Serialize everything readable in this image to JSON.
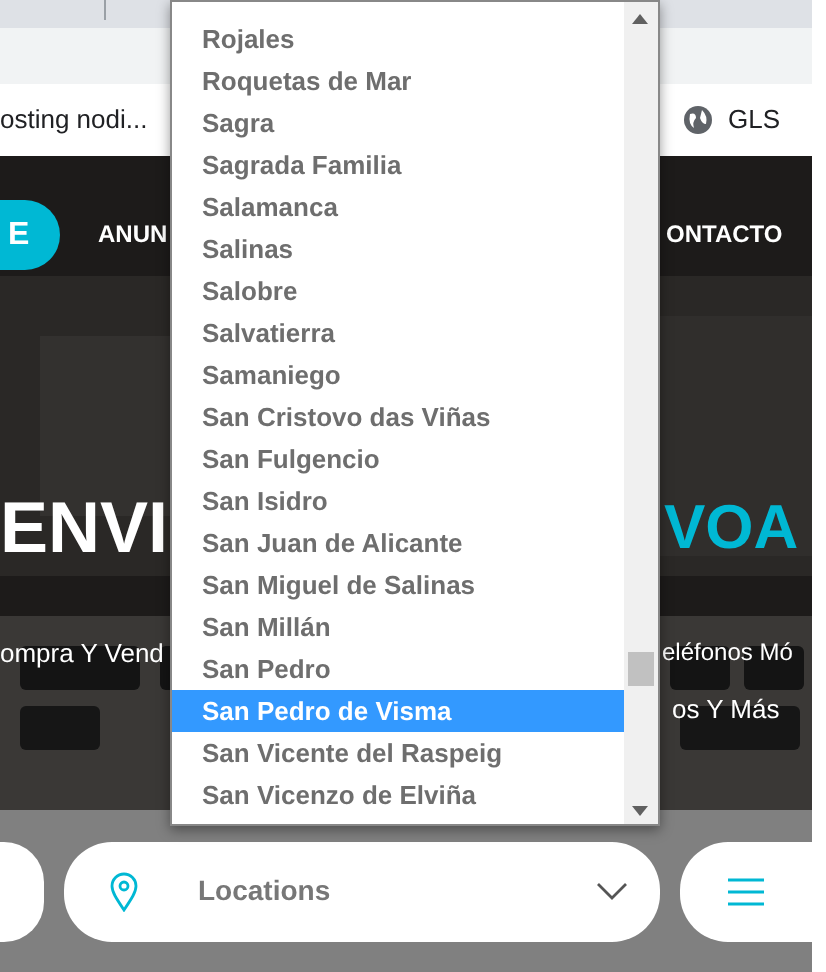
{
  "browser": {
    "bookmark": "osting nodi...",
    "bookmark_right": "GLS"
  },
  "nav": {
    "items": [
      {
        "label": "E",
        "selected": true
      },
      {
        "label": "ANUN",
        "selected": false
      },
      {
        "label": "ONTACTO",
        "selected": false
      }
    ]
  },
  "hero": {
    "title_left": "ENVI",
    "title_right": "VOA",
    "subtitle_left": "ompra Y Vend",
    "subtitle_right": [
      "eléfonos Mó",
      "os Y Más"
    ]
  },
  "search": {
    "location_field": {
      "value": "Locations"
    }
  },
  "dropdown": {
    "options": [
      {
        "label": "Rojales",
        "selected": false
      },
      {
        "label": "Roquetas de Mar",
        "selected": false
      },
      {
        "label": "Sagra",
        "selected": false
      },
      {
        "label": "Sagrada Familia",
        "selected": false
      },
      {
        "label": "Salamanca",
        "selected": false
      },
      {
        "label": "Salinas",
        "selected": false
      },
      {
        "label": "Salobre",
        "selected": false
      },
      {
        "label": "Salvatierra",
        "selected": false
      },
      {
        "label": "Samaniego",
        "selected": false
      },
      {
        "label": "San Cristovo das Viñas",
        "selected": false
      },
      {
        "label": "San Fulgencio",
        "selected": false
      },
      {
        "label": "San Isidro",
        "selected": false
      },
      {
        "label": "San Juan de Alicante",
        "selected": false
      },
      {
        "label": "San Miguel de Salinas",
        "selected": false
      },
      {
        "label": "San Millán",
        "selected": false
      },
      {
        "label": "San Pedro",
        "selected": false
      },
      {
        "label": "San Pedro de Visma",
        "selected": true
      },
      {
        "label": "San Vicente del Raspeig",
        "selected": false
      },
      {
        "label": "San Vicenzo de Elviña",
        "selected": false
      }
    ]
  }
}
